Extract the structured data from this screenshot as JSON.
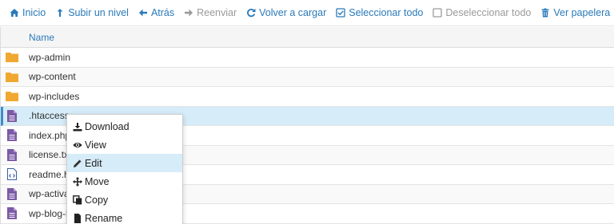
{
  "toolbar": {
    "home_label": "Inicio",
    "up_label": "Subir un nivel",
    "back_label": "Atrás",
    "forward_label": "Reenviar",
    "reload_label": "Volver a cargar",
    "select_all_label": "Seleccionar todo",
    "deselect_all_label": "Deseleccionar todo",
    "trash_label": "Ver papelera"
  },
  "table": {
    "header_name": "Name",
    "rows": [
      {
        "name": "wp-admin",
        "type": "folder"
      },
      {
        "name": "wp-content",
        "type": "folder"
      },
      {
        "name": "wp-includes",
        "type": "folder"
      },
      {
        "name": ".htaccess",
        "type": "file",
        "selected": true
      },
      {
        "name": "index.php",
        "type": "file"
      },
      {
        "name": "license.txt",
        "type": "file"
      },
      {
        "name": "readme.h",
        "type": "html-file"
      },
      {
        "name": "wp-activa",
        "type": "file"
      },
      {
        "name": "wp-blog-h",
        "type": "file"
      }
    ]
  },
  "context_menu": {
    "items": [
      {
        "label": "Download",
        "icon": "download-icon"
      },
      {
        "label": "View",
        "icon": "eye-icon"
      },
      {
        "label": "Edit",
        "icon": "pencil-icon",
        "active": true
      },
      {
        "label": "Move",
        "icon": "move-icon"
      },
      {
        "label": "Copy",
        "icon": "copy-icon"
      },
      {
        "label": "Rename",
        "icon": "file-icon"
      }
    ]
  },
  "colors": {
    "accent": "#2a7ab9",
    "folder": "#f0a830",
    "file": "#7b5aa6",
    "selected_row": "#d6ecf8"
  }
}
